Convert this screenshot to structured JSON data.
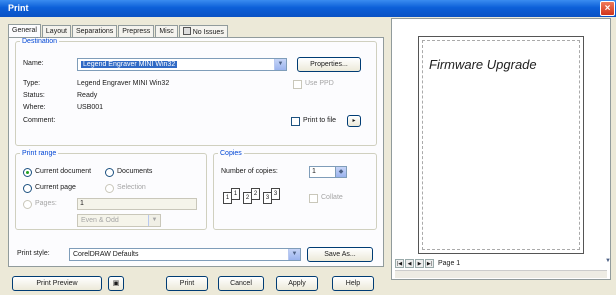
{
  "window": {
    "title": "Print"
  },
  "tabs": [
    {
      "label": "General"
    },
    {
      "label": "Layout"
    },
    {
      "label": "Separations"
    },
    {
      "label": "Prepress"
    },
    {
      "label": "Misc"
    },
    {
      "label": "No Issues"
    }
  ],
  "destination": {
    "legend": "Destination",
    "name_label": "Name:",
    "name_value": "Legend Engraver MINI Win32",
    "properties_label": "Properties...",
    "type_label": "Type:",
    "type_value": "Legend Engraver MINI Win32",
    "status_label": "Status:",
    "status_value": "Ready",
    "where_label": "Where:",
    "where_value": "USB001",
    "comment_label": "Comment:",
    "use_ppd_label": "Use PPD",
    "print_to_file_label": "Print to file"
  },
  "print_range": {
    "legend": "Print range",
    "current_document": "Current document",
    "documents": "Documents",
    "current_page": "Current page",
    "selection": "Selection",
    "pages": "Pages:",
    "pages_value": "1",
    "even_odd": "Even & Odd"
  },
  "copies": {
    "legend": "Copies",
    "number_label": "Number of copies:",
    "number_value": "1",
    "collate_label": "Collate"
  },
  "print_style": {
    "label": "Print style:",
    "value": "CorelDRAW Defaults",
    "save_as_label": "Save As..."
  },
  "buttons": {
    "print_preview": "Print Preview",
    "print": "Print",
    "cancel": "Cancel",
    "apply": "Apply",
    "help": "Help"
  },
  "preview": {
    "page_text": "Firmware Upgrade",
    "page_tab": "Page 1"
  }
}
